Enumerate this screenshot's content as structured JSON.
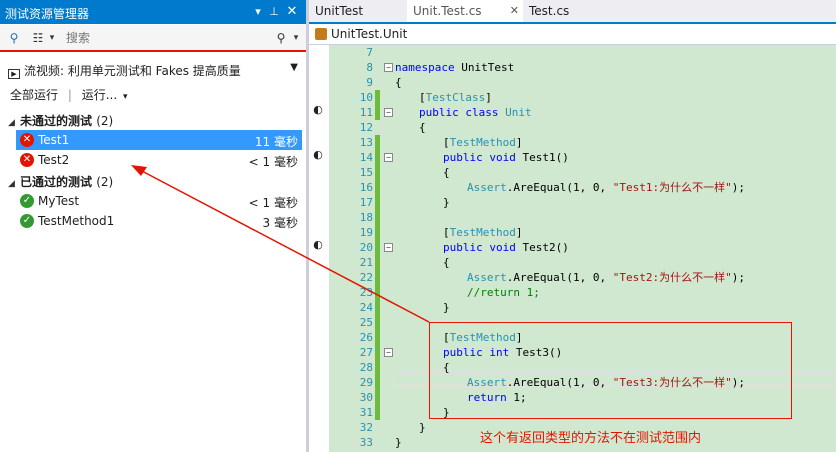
{
  "explorer": {
    "title": "测试资源管理器",
    "title_icons": [
      "dropdown-icon",
      "pin-icon",
      "close-icon"
    ],
    "search_placeholder": "搜索",
    "video_link": "流视频: 利用单元测试和 Fakes 提高质量",
    "run_all": "全部运行",
    "run_menu": "运行...",
    "failed_group": {
      "label": "未通过的测试",
      "count": "(2)"
    },
    "passed_group": {
      "label": "已通过的测试",
      "count": "(2)"
    },
    "failed_tests": [
      {
        "name": "Test1",
        "duration": "11 毫秒"
      },
      {
        "name": "Test2",
        "duration": "< 1 毫秒"
      }
    ],
    "passed_tests": [
      {
        "name": "MyTest",
        "duration": "< 1 毫秒"
      },
      {
        "name": "TestMethod1",
        "duration": "3 毫秒"
      }
    ]
  },
  "editor": {
    "tabs": [
      {
        "label": "UnitTest"
      },
      {
        "label": "Unit.Test.cs"
      },
      {
        "label": "Test.cs"
      }
    ],
    "navbar": "UnitTest.Unit",
    "line_numbers": [
      "7",
      "8",
      "9",
      "10",
      "11",
      "12",
      "13",
      "14",
      "15",
      "16",
      "17",
      "18",
      "19",
      "20",
      "21",
      "22",
      "23",
      "24",
      "25",
      "26",
      "27",
      "28",
      "29",
      "30",
      "31",
      "32",
      "33"
    ],
    "lines": {
      "l8_kw": "namespace",
      "l8_rest": " UnitTest",
      "l9": "{",
      "l10_a": "[",
      "l10_ty": "TestClass",
      "l10_b": "]",
      "l11_kw": "public class",
      "l11_ty": " Unit",
      "l12": "{",
      "l13_a": "[",
      "l13_ty": "TestMethod",
      "l13_b": "]",
      "l14_kw": "public void",
      "l14_rest": " Test1()",
      "l15": "{",
      "l16_ty": "Assert",
      "l16_rest": ".AreEqual(1, 0, ",
      "l16_str": "\"Test1:为什么不一样\"",
      "l16_end": ");",
      "l17": "}",
      "l19_a": "[",
      "l19_ty": "TestMethod",
      "l19_b": "]",
      "l20_kw": "public void",
      "l20_rest": " Test2()",
      "l21": "{",
      "l22_ty": "Assert",
      "l22_rest": ".AreEqual(1, 0, ",
      "l22_str": "\"Test2:为什么不一样\"",
      "l22_end": ");",
      "l23_cm": "//return 1;",
      "l24": "}",
      "l26_a": "[",
      "l26_ty": "TestMethod",
      "l26_b": "]",
      "l27_kw": "public int",
      "l27_rest": " Test3()",
      "l28": "{",
      "l29_ty": "Assert",
      "l29_rest": ".AreEqual(1, 0, ",
      "l29_str": "\"Test3:为什么不一样\"",
      "l29_end": ");",
      "l30_kw": "return",
      "l30_rest": " 1;",
      "l31": "}",
      "l32": "}",
      "l33": "}"
    }
  },
  "annotation": {
    "text": "这个有返回类型的方法不在测试范围内",
    "color": "#e51400"
  },
  "colors": {
    "accent": "#007acc",
    "selection": "#3399ff",
    "fail": "#e51400",
    "pass": "#339933",
    "code_background": "#cfe8cf"
  }
}
